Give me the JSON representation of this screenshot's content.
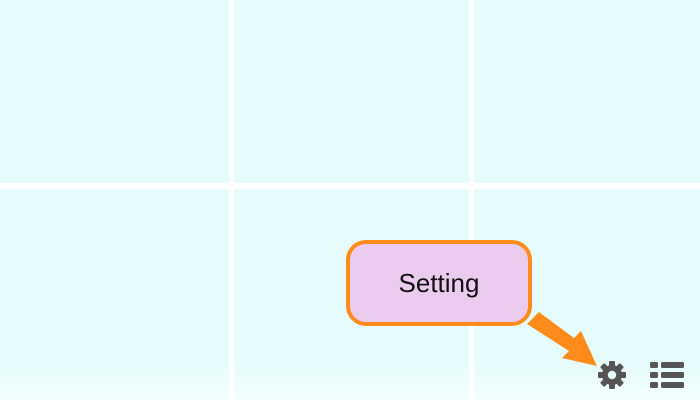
{
  "callout": {
    "label": "Setting"
  },
  "toolbar": {
    "settings_icon": "gear-icon",
    "list_icon": "list-icon"
  },
  "colors": {
    "cell_background": "#e6fcfc",
    "callout_fill": "#ecccee",
    "callout_border": "#ff8c1a",
    "arrow": "#ff8c1a",
    "icon": "#555555"
  }
}
